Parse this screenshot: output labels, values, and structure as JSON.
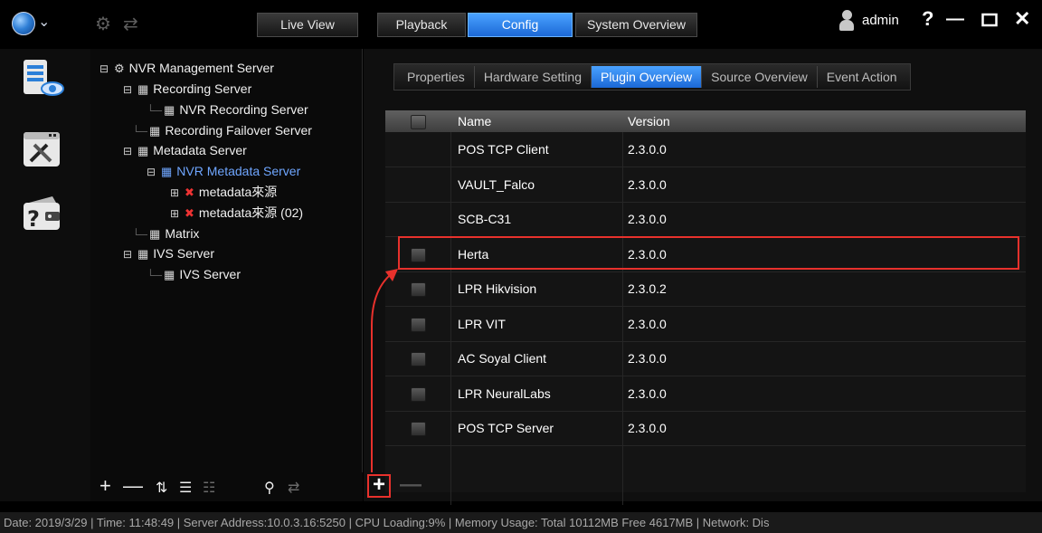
{
  "header": {
    "main_tabs": [
      {
        "label": "Live View",
        "active": false
      },
      {
        "label": "Playback",
        "active": false
      },
      {
        "label": "Config",
        "active": true
      },
      {
        "label": "System Overview",
        "active": false
      }
    ],
    "user": "admin",
    "help": "?"
  },
  "tree": {
    "items": [
      {
        "label": "NVR Management Server"
      },
      {
        "label": "Recording Server"
      },
      {
        "label": "NVR Recording Server"
      },
      {
        "label": "Recording Failover Server"
      },
      {
        "label": "Metadata Server"
      },
      {
        "label": "NVR Metadata Server"
      },
      {
        "label": "metadata來源"
      },
      {
        "label": "metadata來源 (02)"
      },
      {
        "label": "Matrix"
      },
      {
        "label": "IVS Server"
      },
      {
        "label": "IVS Server"
      }
    ]
  },
  "subtabs": [
    {
      "label": "Properties",
      "active": false
    },
    {
      "label": "Hardware Setting",
      "active": false
    },
    {
      "label": "Plugin Overview",
      "active": true
    },
    {
      "label": "Source Overview",
      "active": false
    },
    {
      "label": "Event Action",
      "active": false
    }
  ],
  "grid": {
    "columns": [
      "Name",
      "Version"
    ],
    "rows": [
      {
        "name": "POS TCP Client",
        "version": "2.3.0.0"
      },
      {
        "name": "VAULT_Falco",
        "version": "2.3.0.0"
      },
      {
        "name": "SCB-C31",
        "version": "2.3.0.0"
      },
      {
        "name": "Herta",
        "version": "2.3.0.0"
      },
      {
        "name": "LPR Hikvision",
        "version": "2.3.0.2"
      },
      {
        "name": "LPR VIT",
        "version": "2.3.0.0"
      },
      {
        "name": "AC Soyal Client",
        "version": "2.3.0.0"
      },
      {
        "name": "LPR NeuralLabs",
        "version": "2.3.0.0"
      },
      {
        "name": "POS TCP Server",
        "version": "2.3.0.0"
      }
    ]
  },
  "status_bar": "Date: 2019/3/29  |  Time: 11:48:49  |  Server Address:10.0.3.16:5250  |  CPU Loading:9%  |  Memory Usage: Total 10112MB  Free 4617MB  |  Network: Dis",
  "colors": {
    "accent": "#2b86f0",
    "highlight": "#e8312c",
    "tree_selected": "#6fa6ff"
  }
}
